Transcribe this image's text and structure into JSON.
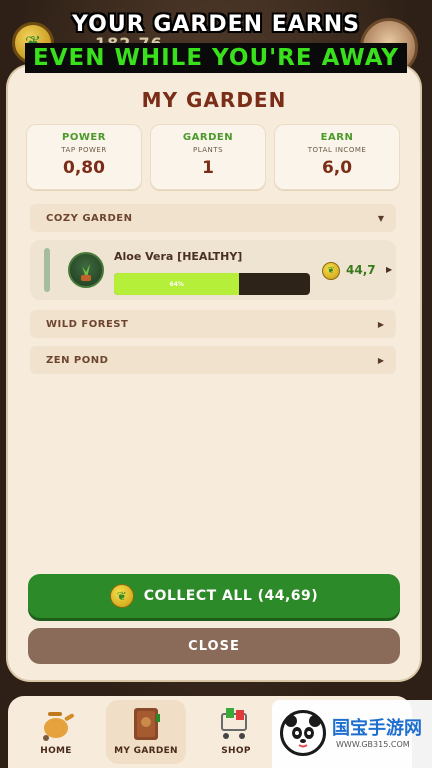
{
  "banner": {
    "line1": "YOUR GARDEN EARNS",
    "line2": "EVEN WHILE YOU'RE AWAY"
  },
  "top_bar": {
    "balance": "182.76",
    "coin_icon": "leaf-coin-icon",
    "avatar_icon": "avatar-icon"
  },
  "panel": {
    "title": "MY GARDEN",
    "stats": [
      {
        "label": "POWER",
        "sub": "TAP POWER",
        "value": "0,80"
      },
      {
        "label": "GARDEN",
        "sub": "PLANTS",
        "value": "1"
      },
      {
        "label": "EARN",
        "sub": "TOTAL INCOME",
        "value": "6,0"
      }
    ],
    "sections": [
      {
        "label": "COZY GARDEN",
        "expanded": true
      },
      {
        "label": "WILD FOREST",
        "expanded": false
      },
      {
        "label": "ZEN POND",
        "expanded": false
      }
    ],
    "plant": {
      "name": "Aloe Vera [HEALTHY]",
      "progress_label": "64%",
      "progress_fraction": 0.64,
      "earn": "44,7"
    },
    "collect_label": "COLLECT ALL (44,69)",
    "close_label": "CLOSE"
  },
  "nav": {
    "items": [
      {
        "label": "HOME",
        "icon": "watering-can-icon",
        "active": false
      },
      {
        "label": "MY GARDEN",
        "icon": "garden-book-icon",
        "active": true
      },
      {
        "label": "SHOP",
        "icon": "shopping-cart-icon",
        "active": false
      }
    ]
  },
  "watermark": {
    "text": "国宝手游网",
    "url": "WWW.GB315.COM"
  },
  "colors": {
    "accent_green": "#2d8a28",
    "title_brown": "#7a2e18",
    "progress_fill": "#b5ef3a",
    "banner_green": "#39e01c"
  }
}
